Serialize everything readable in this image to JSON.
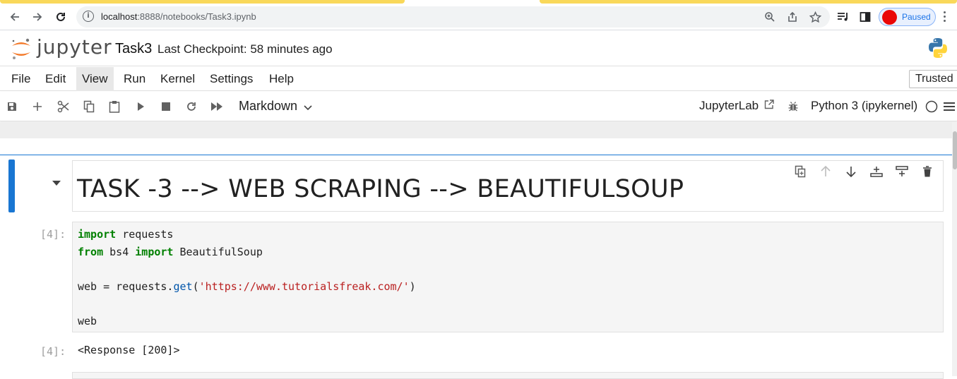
{
  "browser": {
    "url_host": "localhost",
    "url_path": ":8888/notebooks/Task3.ipynb",
    "profile_status": "Paused",
    "accent_color": "#1a73e8",
    "profile_color": "#ea0707"
  },
  "header": {
    "logo_text": "jupyter",
    "notebook_title": "Task3",
    "checkpoint": "Last Checkpoint: 58 minutes ago"
  },
  "menu": {
    "items": [
      "File",
      "Edit",
      "View",
      "Run",
      "Kernel",
      "Settings",
      "Help"
    ],
    "active_item": "View",
    "trusted_label": "Trusted"
  },
  "toolbar": {
    "icons": [
      "save-icon",
      "add-icon",
      "cut-icon",
      "copy-icon",
      "paste-icon",
      "run-icon",
      "stop-icon",
      "restart-icon",
      "fast-forward-icon"
    ],
    "cell_type": "Markdown",
    "jupyterlab_label": "JupyterLab",
    "kernel_name": "Python 3 (ipykernel)"
  },
  "cells": {
    "markdown_heading": "TASK -3 --> WEB SCRAPING --> BEAUTIFULSOUP",
    "code_prompt": "[4]:",
    "code_lines": [
      {
        "kw1": "import",
        "rest1": " requests"
      },
      {
        "kw1": "from",
        "mid": " bs4 ",
        "kw2": "import",
        "rest2": " BeautifulSoup"
      },
      {
        "var": "web",
        "op": " = requests.",
        "fn": "get",
        "open": "(",
        "str": "'https://www.tutorialsfreak.com/'",
        "close": ")"
      },
      {
        "plain": "web"
      }
    ],
    "output_prompt": "[4]:",
    "output_text": "<Response [200]>"
  }
}
